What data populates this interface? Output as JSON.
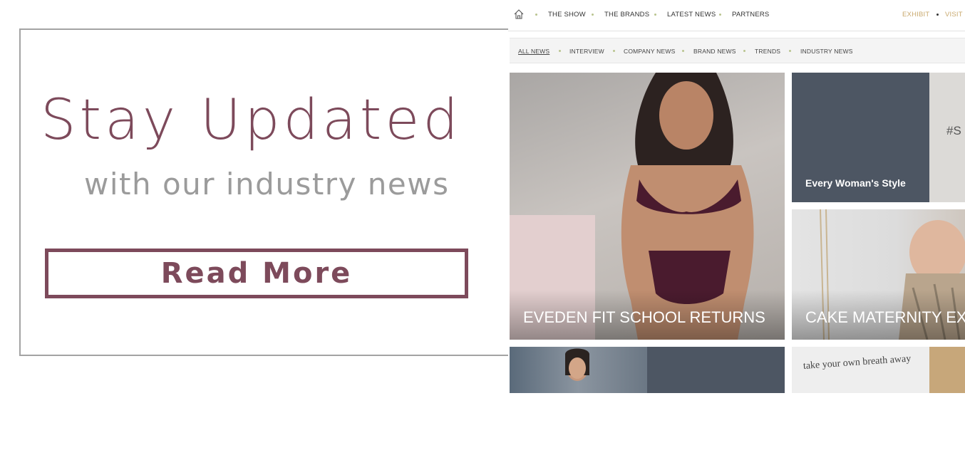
{
  "promo": {
    "title": "Stay Updated",
    "subtitle": "with our industry news",
    "button_label": "Read More"
  },
  "site": {
    "nav": {
      "items": [
        "THE SHOW",
        "THE BRANDS",
        "LATEST NEWS",
        "PARTNERS"
      ],
      "exhibit": "EXHIBIT",
      "visit": "VISIT"
    },
    "filters": [
      "ALL NEWS",
      "INTERVIEW",
      "COMPANY NEWS",
      "BRAND NEWS",
      "TRENDS",
      "INDUSTRY NEWS"
    ],
    "tiles": {
      "eveden": "EVEDEN FIT SCHOOL RETURNS",
      "every_woman": "Every Woman's Style",
      "hashtag": "#S",
      "cake": "CAKE MATERNITY EXPA",
      "breath": "take your own breath away"
    }
  },
  "colors": {
    "accent": "#7d4a5b",
    "subtitle": "#9b9b9b",
    "gold": "#c9a96e",
    "slate": "#4d5663"
  }
}
